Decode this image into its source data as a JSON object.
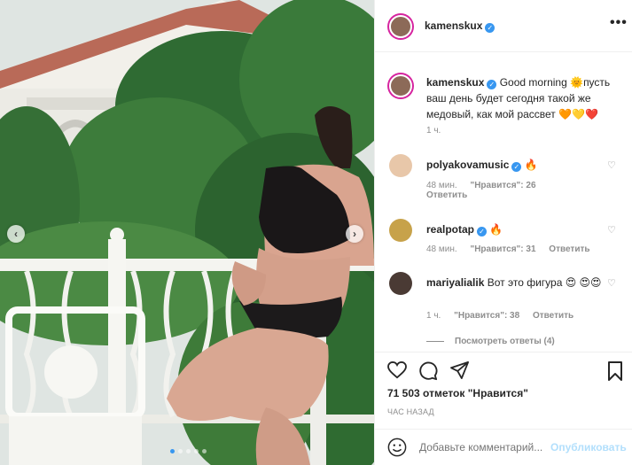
{
  "post": {
    "author": "kamenskux",
    "more_icon": "ellipsis-icon",
    "caption": {
      "username": "kamenskux",
      "text_a": "Good morning ",
      "sun": "🌞",
      "text_b": "пусть ваш день будет сегодня такой же медовый, как мой рассвет ",
      "hearts": "🧡💛❤️",
      "time": "1 ч."
    },
    "comments": [
      {
        "username": "polyakovamusic",
        "text": "🔥",
        "time": "48 мин.",
        "likes": "\"Нравится\": 26",
        "reply": "Ответить"
      },
      {
        "username": "realpotap",
        "text": "🔥",
        "time": "48 мин.",
        "likes": "\"Нравится\": 31",
        "reply": "Ответить"
      },
      {
        "username": "mariyalialik",
        "text": "Вот это фигура 😍 😍😍",
        "time": "1 ч.",
        "likes": "\"Нравится\": 38",
        "reply": "Ответить"
      }
    ],
    "view_replies": "Посмотреть ответы (4)",
    "likes_count": "71 503 отметок \"Нравится\"",
    "posted_ago": "ЧАС НАЗАД",
    "add_comment_placeholder": "Добавьте комментарий...",
    "publish_label": "Опубликовать"
  },
  "carousel": {
    "slides": 5,
    "active_index": 0
  },
  "colors": {
    "accent": "#3897f0",
    "muted": "#8e8e8e",
    "publish_disabled": "#b2dffc",
    "story_ring": "#d6249f"
  }
}
